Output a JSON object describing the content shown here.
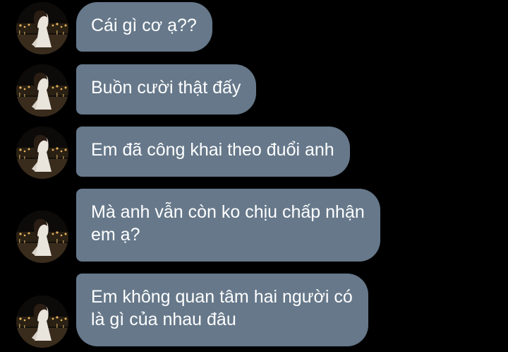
{
  "conversation": {
    "messages": [
      {
        "text": "Cái gì cơ ạ??"
      },
      {
        "text": "Buồn cười thật đấy"
      },
      {
        "text": "Em đã công khai theo đuổi anh"
      },
      {
        "text": "Mà anh vẫn còn ko chịu chấp nhận\nem ạ?"
      },
      {
        "text": "Em không quan tâm hai người có\nlà gì của nhau đâu"
      }
    ]
  },
  "colors": {
    "background": "#000000",
    "bubble": "#66788a",
    "text": "#ffffff"
  },
  "icons": {
    "avatar": "contact-avatar-photo"
  }
}
